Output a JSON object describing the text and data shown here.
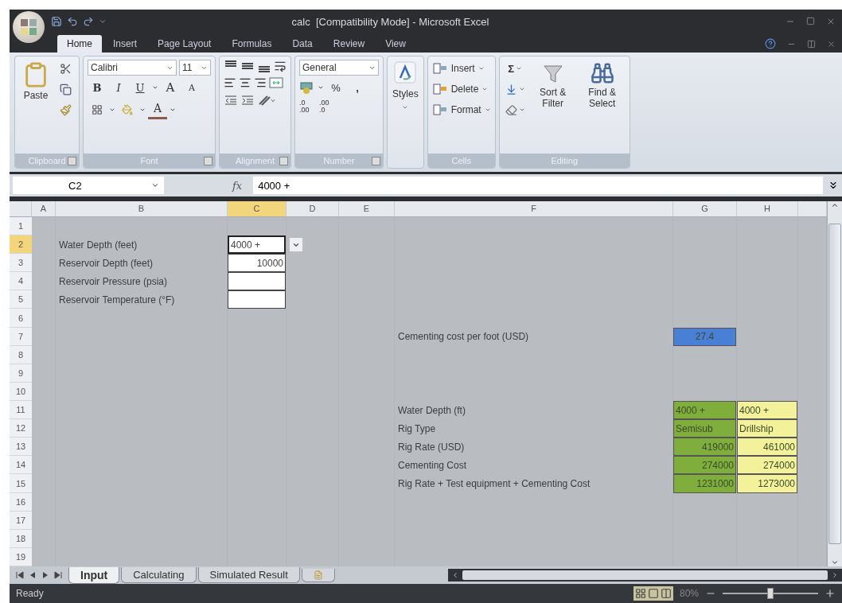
{
  "window": {
    "title": "calc  [Compatibility Mode] - Microsoft Excel"
  },
  "ribbon_tabs": [
    {
      "label": "Home",
      "selected": true
    },
    {
      "label": "Insert",
      "selected": false
    },
    {
      "label": "Page Layout",
      "selected": false
    },
    {
      "label": "Formulas",
      "selected": false
    },
    {
      "label": "Data",
      "selected": false
    },
    {
      "label": "Review",
      "selected": false
    },
    {
      "label": "View",
      "selected": false
    }
  ],
  "ribbon": {
    "clipboard": {
      "label": "Clipboard",
      "paste": "Paste"
    },
    "font": {
      "label": "Font",
      "font_name": "Calibri",
      "font_size": "11",
      "bold": "B",
      "italic": "I",
      "underline": "U",
      "grow": "A",
      "shrink": "A",
      "font_color_letter": "A"
    },
    "alignment": {
      "label": "Alignment"
    },
    "number": {
      "label": "Number",
      "format": "General",
      "percent": "%",
      "comma": ",",
      "increase_decimal": ".0 .00",
      "decrease_decimal": ".00 .0"
    },
    "styles": {
      "label": "Styles"
    },
    "cells": {
      "label": "Cells",
      "buttons": [
        "Insert",
        "Delete",
        "Format"
      ]
    },
    "editing": {
      "label": "Editing",
      "sum": "Σ",
      "sort": "Sort & Filter",
      "find": "Find & Select"
    }
  },
  "formula_bar": {
    "name_box": "C2",
    "fx": "fx",
    "formula": "4000 +"
  },
  "sheet": {
    "columns": [
      {
        "label": "A",
        "selected": false
      },
      {
        "label": "B",
        "selected": false
      },
      {
        "label": "C",
        "selected": true
      },
      {
        "label": "D",
        "selected": false
      },
      {
        "label": "E",
        "selected": false
      },
      {
        "label": "F",
        "selected": false
      },
      {
        "label": "G",
        "selected": false
      },
      {
        "label": "H",
        "selected": false
      }
    ],
    "rows": [
      {
        "number": "1",
        "selected": false
      },
      {
        "number": "2",
        "selected": true
      },
      {
        "number": "3",
        "selected": false
      },
      {
        "number": "4",
        "selected": false
      },
      {
        "number": "5",
        "selected": false
      },
      {
        "number": "6",
        "selected": false
      },
      {
        "number": "7",
        "selected": false
      },
      {
        "number": "8",
        "selected": false
      },
      {
        "number": "9",
        "selected": false
      },
      {
        "number": "10",
        "selected": false
      },
      {
        "number": "11",
        "selected": false
      },
      {
        "number": "12",
        "selected": false
      },
      {
        "number": "13",
        "selected": false
      },
      {
        "number": "14",
        "selected": false
      },
      {
        "number": "15",
        "selected": false
      },
      {
        "number": "16",
        "selected": false
      },
      {
        "number": "17",
        "selected": false
      },
      {
        "number": "18",
        "selected": false
      },
      {
        "number": "19",
        "selected": false
      }
    ],
    "inputs": [
      {
        "label": "Water Depth (feet)",
        "value": "4000 +",
        "numeric": false,
        "selected": true
      },
      {
        "label": "Reservoir Depth (feet)",
        "value": "10000",
        "numeric": true,
        "selected": false
      },
      {
        "label": "Reservoir Pressure (psia)",
        "selected": false
      },
      {
        "label": "Reservoir Temperature (°F)",
        "selected": false
      }
    ],
    "cost_per_foot": {
      "label": "Cementing cost per foot (USD)",
      "value": "27.4",
      "color": "#4a7fd6"
    },
    "comparison": [
      {
        "label": "Water Depth (ft)",
        "numeric": false,
        "values": [
          {
            "text": "4000 +",
            "color": "#7fae3c"
          },
          {
            "text": "4000 +",
            "color": "#f3f29a"
          }
        ]
      },
      {
        "label": "Rig Type",
        "numeric": false,
        "values": [
          {
            "text": "Semisub",
            "color": "#7fae3c"
          },
          {
            "text": "Drillship",
            "color": "#f3f29a"
          }
        ]
      },
      {
        "label": "Rig Rate (USD)",
        "numeric": true,
        "values": [
          {
            "text": "419000",
            "color": "#7fae3c"
          },
          {
            "text": "461000",
            "color": "#f3f29a"
          }
        ]
      },
      {
        "label": "Cementing Cost",
        "numeric": true,
        "values": [
          {
            "text": "274000",
            "color": "#7fae3c"
          },
          {
            "text": "274000",
            "color": "#f3f29a"
          }
        ]
      },
      {
        "label": "Rig Rate + Test equipment + Cementing Cost",
        "numeric": true,
        "values": [
          {
            "text": "1231000",
            "color": "#7fae3c"
          },
          {
            "text": "1273000",
            "color": "#f3f29a"
          }
        ]
      }
    ]
  },
  "sheet_tabs": [
    {
      "label": "Input",
      "selected": true
    },
    {
      "label": "Calculating",
      "selected": false
    },
    {
      "label": "Simulated Result",
      "selected": false
    }
  ],
  "status_bar": {
    "status": "Ready",
    "zoom": "80%",
    "zoom_slider": {
      "level": 0.5
    }
  }
}
